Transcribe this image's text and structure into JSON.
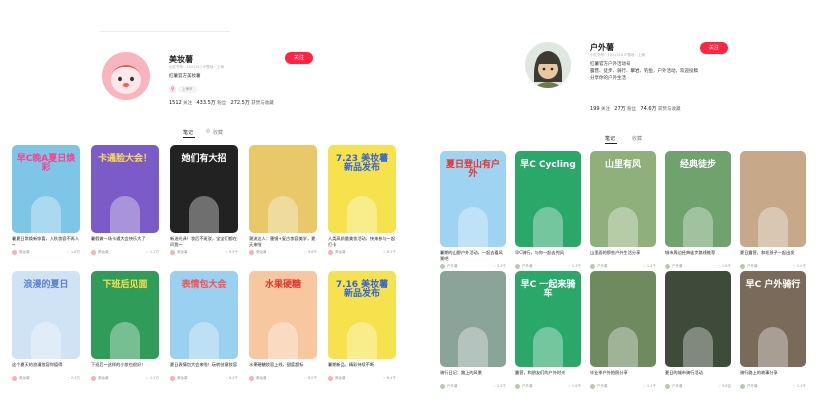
{
  "left": {
    "name": "美妆薯",
    "meta": "小红书号：1021317  IP属地：上海",
    "bio": "红薯官方美妆薯",
    "tag": "上海市",
    "stats": [
      {
        "num": "1512",
        "label": "关注"
      },
      {
        "num": "433.5万",
        "label": "粉丝"
      },
      {
        "num": "272.5万",
        "label": "获赞与收藏"
      }
    ],
    "follow": "关注",
    "tabs": [
      "笔记",
      "收藏"
    ],
    "cards": [
      {
        "cover": "早C晚A夏日焕彩",
        "title": "暑夏日常焕新惊喜，入秋妆容不再人~",
        "author": "美妆薯",
        "likes": "1.8万",
        "bg": "#7ec6e8",
        "fg": "#ff3c8c"
      },
      {
        "cover": "卡通脸大会！",
        "title": "暑假做一场卡通大会快乐大了",
        "author": "美妆薯",
        "likes": "1.2万",
        "bg": "#7b5bc8",
        "fg": "#ffe04a"
      },
      {
        "cover": "她们有大招",
        "title": "新油光泽！妆后不斑驳，宝宝们都在问我～",
        "author": "美妆薯",
        "likes": "9.5千",
        "bg": "#222222",
        "fg": "#ffffff"
      },
      {
        "cover": "",
        "title": "潮流达人：墨镜+复古妆容美学，夏天来啦",
        "author": "美妆薯",
        "likes": "9.6千",
        "bg": "#e9c86a",
        "fg": "#c61b2f"
      },
      {
        "cover": "7.23 美妆薯新品发布",
        "title": "人类高质量美妆活动，快来参与一起打卡",
        "author": "美妆薯",
        "likes": "8.1千",
        "bg": "#f6e24d",
        "fg": "#3264d8"
      },
      {
        "cover": "浪漫的夏日",
        "title": "这个夏天的浪漫妆容你值得",
        "author": "美妆薯",
        "likes": "2.4万",
        "bg": "#cfe3f4",
        "fg": "#5a7fd0"
      },
      {
        "cover": "下班后见面",
        "title": "下班后～这样的小妆也很好！",
        "author": "美妆薯",
        "likes": "1.1万",
        "bg": "#2f9c5a",
        "fg": "#ffe04a"
      },
      {
        "cover": "表情包大会",
        "title": "夏日表情包大会来啦！玩转创意妆容",
        "author": "美妆薯",
        "likes": "6.5千",
        "bg": "#9ad0f0",
        "fg": "#ff4a4a"
      },
      {
        "cover": "水果硬糖",
        "title": "水果硬糖妆容上线，甜度超标",
        "author": "美妆薯",
        "likes": "8.0千",
        "bg": "#f7c7a0",
        "fg": "#e6332a"
      },
      {
        "cover": "7.16 美妆薯新品发布",
        "title": "暑期新品，精彩持续不断",
        "author": "美妆薯",
        "likes": "6.4千",
        "bg": "#f6e24d",
        "fg": "#3264d8"
      }
    ]
  },
  "right": {
    "name": "户外薯",
    "meta": "小红书号：1021318  IP属地：上海",
    "bio_lines": [
      "红薯官方户外活动号",
      "露营、徒步、骑行、攀岩、钓鱼，户外活动，欢迎投稿",
      "分享你的户外生活"
    ],
    "stats": [
      {
        "num": "199",
        "label": "关注"
      },
      {
        "num": "27万",
        "label": "粉丝"
      },
      {
        "num": "74.6万",
        "label": "获赞与收藏"
      }
    ],
    "follow": "关注",
    "tabs": [
      "笔记",
      "收藏"
    ],
    "cards": [
      {
        "cover": "夏日登山有户外",
        "title": "暑期的山野户外活动，一起去看风景吧",
        "author": "户外薯",
        "likes": "3.3千",
        "bg": "#9fd3f2",
        "fg": "#e8312d"
      },
      {
        "cover": "早C Cycling",
        "title": "早C骑行，与你一起去兜风",
        "author": "户外薯",
        "likes": "2.3千",
        "bg": "#2aa86a",
        "fg": "#ffffff"
      },
      {
        "cover": "山里有风",
        "title": "山里面的那些户外生活分享",
        "author": "户外薯",
        "likes": "1.4千",
        "bg": "#8fb07a",
        "fg": "#ffffff"
      },
      {
        "cover": "经典徒步",
        "title": "城市周边经典徒步路线推荐",
        "author": "户外薯",
        "likes": "1.8千",
        "bg": "#6fa26c",
        "fg": "#ffffff"
      },
      {
        "cover": "",
        "title": "夏日露营，和毛孩子一起出发",
        "author": "户外薯",
        "likes": "2.0千",
        "bg": "#c7a98a",
        "fg": "#ffffff"
      },
      {
        "cover": "",
        "title": "骑行日记：路上的风景",
        "author": "户外薯",
        "likes": "1.2千",
        "bg": "#8aa49a",
        "fg": "#ffffff"
      },
      {
        "cover": "早C 一起来骑车",
        "title": "露营，和朋友们的户外时光",
        "author": "户外薯",
        "likes": "1.6千",
        "bg": "#2aa86a",
        "fg": "#ffffff"
      },
      {
        "cover": "",
        "title": "毕业季户外拍照分享",
        "author": "户外薯",
        "likes": "1.1千",
        "bg": "#6f8a5f",
        "fg": "#ffffff"
      },
      {
        "cover": "",
        "title": "夏日的城市骑行活动",
        "author": "户外薯",
        "likes": "9.8百",
        "bg": "#3e4a3a",
        "fg": "#ffffff"
      },
      {
        "cover": "早C 户外骑行",
        "title": "骑行路上的故事分享",
        "author": "户外薯",
        "likes": "1.3千",
        "bg": "#7a6a5a",
        "fg": "#ffffff"
      }
    ]
  }
}
